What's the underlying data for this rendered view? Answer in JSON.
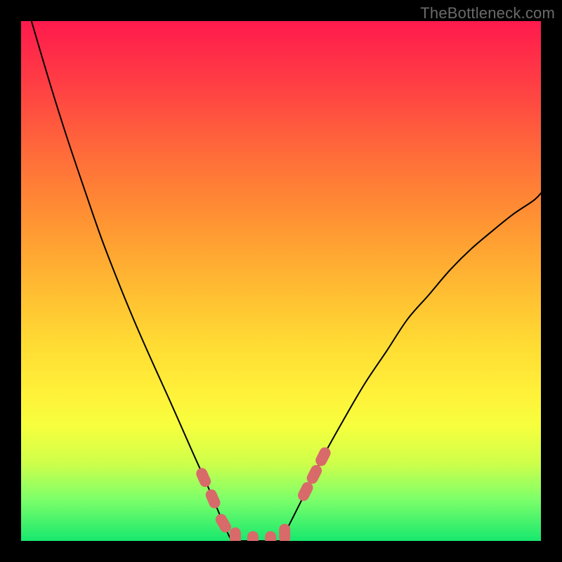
{
  "watermark": "TheBottleneck.com",
  "colors": {
    "page_bg": "#000000",
    "watermark_text": "#6a6a6a",
    "curve_stroke": "#000000",
    "marker_fill": "#d86a6a",
    "gradient_top": "#ff1a4d",
    "gradient_bottom": "#17e86e"
  },
  "chart_data": {
    "type": "line",
    "title": "",
    "xlabel": "",
    "ylabel": "",
    "xlim": [
      0,
      100
    ],
    "ylim": [
      0,
      100
    ],
    "grid": false,
    "legend_position": "none",
    "note": "Axes unlabeled; x/y are percent of plot area (0 = left/bottom, 100 = right/top). Values estimated from pixel positions.",
    "series": [
      {
        "name": "left_curve",
        "x": [
          2.0,
          5.4,
          8.8,
          12.2,
          15.5,
          18.9,
          22.3,
          25.7,
          29.1,
          32.4,
          35.8,
          39.2,
          40.5
        ],
        "y": [
          100.0,
          88.5,
          77.7,
          67.6,
          58.1,
          49.3,
          41.1,
          33.4,
          25.9,
          18.4,
          10.8,
          2.7,
          0.0
        ]
      },
      {
        "name": "floor",
        "x": [
          40.5,
          50.0
        ],
        "y": [
          0.0,
          0.0
        ]
      },
      {
        "name": "right_curve",
        "x": [
          50.0,
          54.1,
          58.1,
          62.2,
          66.2,
          70.3,
          74.3,
          78.4,
          82.4,
          86.5,
          90.5,
          94.6,
          98.6,
          100.0
        ],
        "y": [
          0.0,
          8.1,
          16.2,
          23.6,
          30.4,
          36.5,
          42.6,
          47.3,
          52.0,
          56.1,
          59.5,
          62.8,
          65.5,
          66.9
        ]
      }
    ],
    "markers": {
      "name": "highlight_points",
      "style": "capsule",
      "color": "#d86a6a",
      "points": [
        {
          "x": 35.1,
          "y": 12.2
        },
        {
          "x": 36.9,
          "y": 8.1
        },
        {
          "x": 38.9,
          "y": 3.4
        },
        {
          "x": 41.2,
          "y": 0.7
        },
        {
          "x": 44.6,
          "y": 0.0
        },
        {
          "x": 48.0,
          "y": 0.0
        },
        {
          "x": 50.7,
          "y": 1.4
        },
        {
          "x": 54.7,
          "y": 9.5
        },
        {
          "x": 56.4,
          "y": 12.8
        },
        {
          "x": 58.1,
          "y": 16.2
        }
      ]
    }
  }
}
